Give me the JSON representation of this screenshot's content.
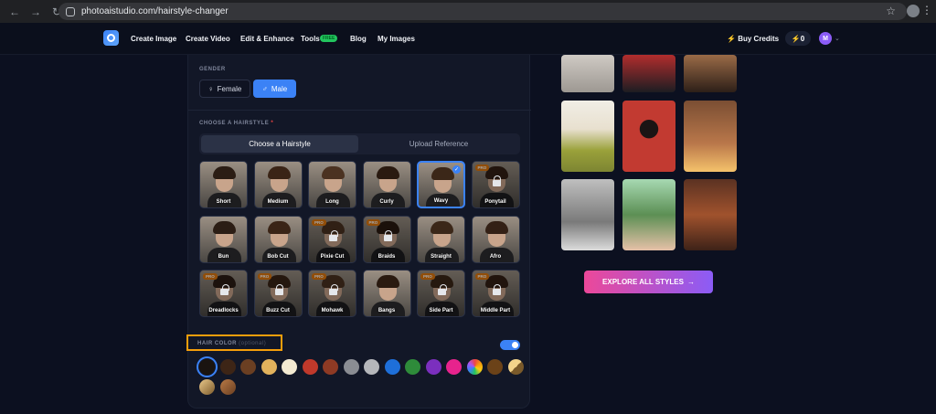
{
  "browser": {
    "url": "photoaistudio.com/hairstyle-changer",
    "nav_icons": [
      "back-icon",
      "forward-icon",
      "reload-icon"
    ]
  },
  "header": {
    "nav": [
      "Create Image",
      "Create Video",
      "Edit & Enhance",
      "Tools",
      "Blog",
      "My Images"
    ],
    "tools_badge": "FREE",
    "buy_credits": "Buy Credits",
    "credits": "0",
    "avatar_initial": "M"
  },
  "gender": {
    "label": "GENDER",
    "female": "Female",
    "male": "Male",
    "selected": "Male"
  },
  "hairstyle": {
    "label": "CHOOSE A HAIRSTYLE",
    "required_mark": "*",
    "tab_choose": "Choose a Hairstyle",
    "tab_upload": "Upload Reference",
    "pro_label": "PRO",
    "tiles": [
      {
        "name": "Short",
        "pro": false
      },
      {
        "name": "Medium",
        "pro": false
      },
      {
        "name": "Long",
        "pro": false
      },
      {
        "name": "Curly",
        "pro": false
      },
      {
        "name": "Wavy",
        "pro": false,
        "selected": true
      },
      {
        "name": "Ponytail",
        "pro": true
      },
      {
        "name": "Bun",
        "pro": false
      },
      {
        "name": "Bob Cut",
        "pro": false
      },
      {
        "name": "Pixie Cut",
        "pro": true
      },
      {
        "name": "Braids",
        "pro": true
      },
      {
        "name": "Straight",
        "pro": false
      },
      {
        "name": "Afro",
        "pro": false
      },
      {
        "name": "Dreadlocks",
        "pro": true
      },
      {
        "name": "Buzz Cut",
        "pro": true
      },
      {
        "name": "Mohawk",
        "pro": true
      },
      {
        "name": "Bangs",
        "pro": false
      },
      {
        "name": "Side Part",
        "pro": true
      },
      {
        "name": "Middle Part",
        "pro": true
      }
    ]
  },
  "hair_color": {
    "label": "HAIR COLOR",
    "optional": "(optional)",
    "enabled": true,
    "swatches": [
      "#1a1410",
      "#3d2516",
      "#6b3f22",
      "#e2b25c",
      "#f3ead2",
      "#c0392b",
      "#8e3a24",
      "#8a8d93",
      "#b5b7bb",
      "#1e6fd9",
      "#2e8b3a",
      "#7b2fbe",
      "#e7238d",
      "rainbow",
      "#6b4218",
      "gold-diag",
      "#b8904f",
      "#8a5a2e"
    ],
    "selected_index": 0
  },
  "gallery": {
    "explore_label": "EXPLORE ALL STYLES",
    "explore_arrow": "→"
  }
}
